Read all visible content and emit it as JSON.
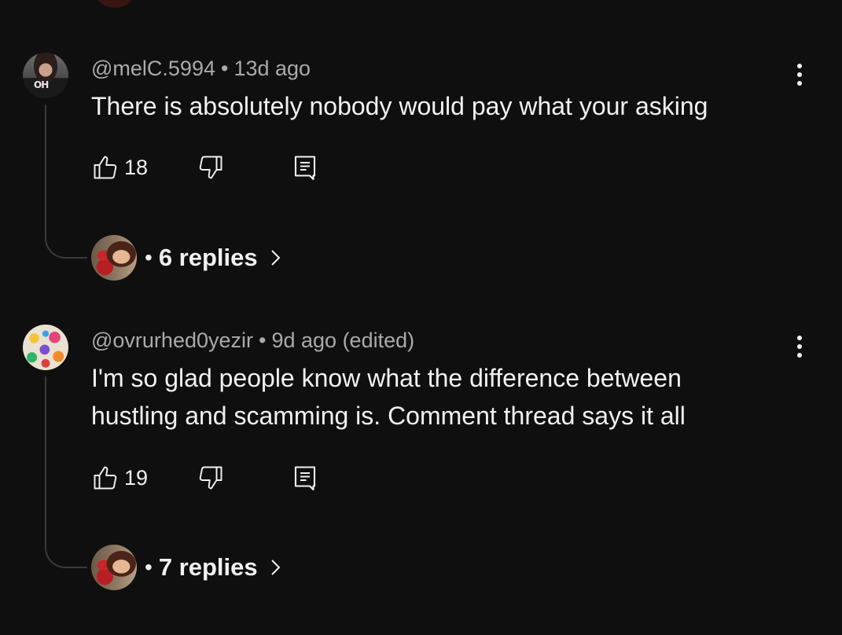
{
  "comments": [
    {
      "handle": "@melC.5994",
      "time": "13d ago",
      "edited": "",
      "text": "There is absolutely nobody would pay what your asking",
      "likes": "18",
      "replies_label": "6 replies",
      "avatar_shirt_text": "OH"
    },
    {
      "handle": "@ovrurhed0yezir",
      "time": "9d ago",
      "edited": "(edited)",
      "text": "I'm so glad people know what the difference between hustling and scamming is. Comment thread says it all",
      "likes": "19",
      "replies_label": "7 replies"
    }
  ],
  "icons": {
    "like": "thumbs-up-icon",
    "dislike": "thumbs-down-icon",
    "reply": "comment-reply-icon",
    "more": "more-vertical-icon",
    "chevron": "chevron-right-icon"
  }
}
